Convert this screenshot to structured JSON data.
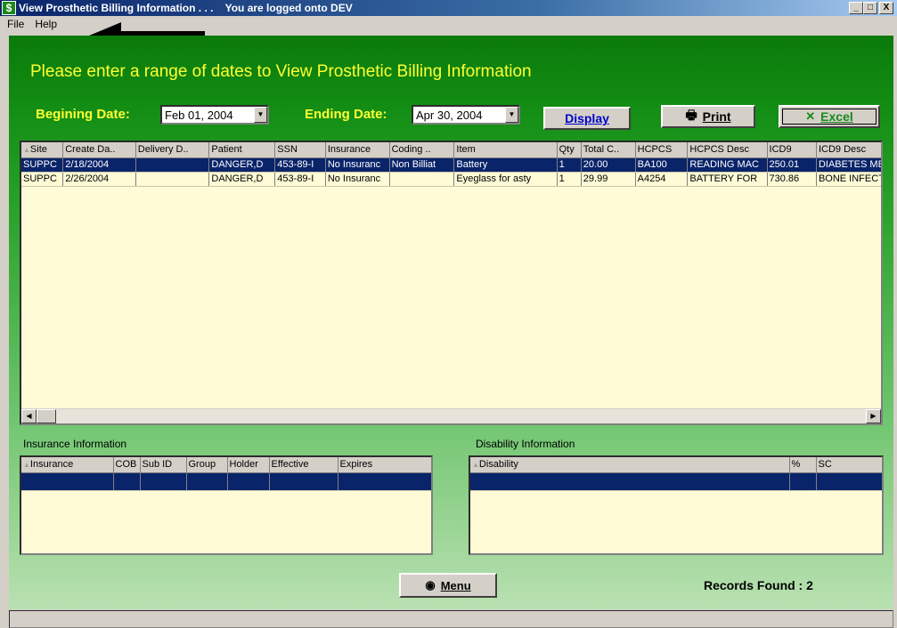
{
  "window": {
    "icon": "$",
    "title": "View Prosthetic Billing Information . . .    You are logged onto DEV",
    "minimize": "_",
    "maximize": "□",
    "close": "X"
  },
  "menu": {
    "file": "File",
    "help": "Help"
  },
  "heading": "Please enter a range of dates to View Prosthetic Billing Information",
  "filters": {
    "begin_label": "Begining Date:",
    "begin_value": "Feb 01, 2004",
    "end_label": "Ending Date:",
    "end_value": "Apr 30, 2004"
  },
  "buttons": {
    "display": "Display",
    "print": "Print",
    "excel": "Excel",
    "menu": "Menu"
  },
  "billing_grid": {
    "columns": [
      "Site",
      "Create Da..",
      "Delivery D..",
      "Patient",
      "SSN",
      "Insurance",
      "Coding ..",
      "Item",
      "Qty",
      "Total C..",
      "HCPCS",
      "HCPCS Desc",
      "ICD9",
      "ICD9 Desc"
    ],
    "rows": [
      [
        "SUPPC",
        "2/18/2004",
        "",
        "DANGER,D",
        "453-89-I",
        "No Insuranc",
        "Non Billiat",
        "Battery",
        "1",
        "20.00",
        "BA100",
        "READING MAC",
        "250.01",
        "DIABETES MELL"
      ],
      [
        "SUPPC",
        "2/26/2004",
        "",
        "DANGER,D",
        "453-89-I",
        "No Insuranc",
        "",
        "Eyeglass for asty",
        "1",
        "29.99",
        "A4254",
        "BATTERY FOR",
        "730.86",
        "BONE INFECT N"
      ]
    ]
  },
  "insurance": {
    "label": "Insurance Information",
    "columns": [
      "Insurance",
      "COB",
      "Sub ID",
      "Group",
      "Holder",
      "Effective",
      "Expires"
    ]
  },
  "disability": {
    "label": "Disability Information",
    "columns": [
      "Disability",
      "%",
      "SC"
    ]
  },
  "records_found": "Records Found : 2",
  "colors": {
    "accent_yellow": "#ffff33",
    "panel_green": "#138d13",
    "selection": "#0a246a",
    "grid_bg": "#fffbd6"
  }
}
